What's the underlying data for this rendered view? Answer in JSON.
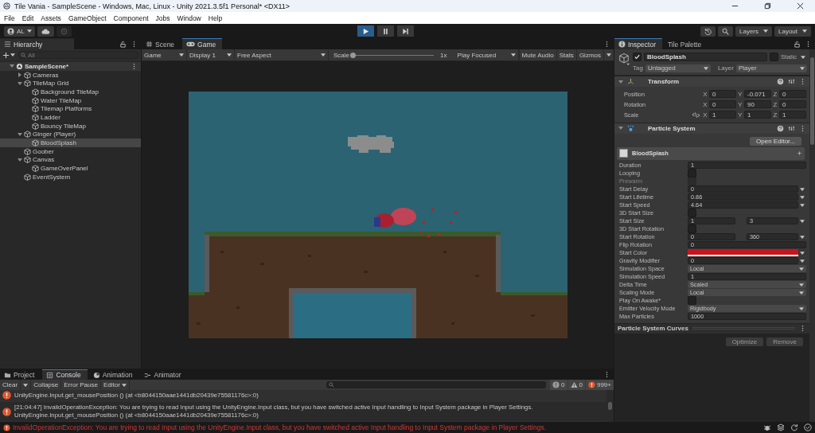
{
  "window": {
    "title": "Tile Vania - SampleScene - Windows, Mac, Linux - Unity 2021.3.5f1 Personal* <DX11>"
  },
  "menu": [
    "File",
    "Edit",
    "Assets",
    "GameObject",
    "Component",
    "Jobs",
    "Window",
    "Help"
  ],
  "toolbar": {
    "account": "AL",
    "playing": true,
    "paused": false,
    "layers": "Layers",
    "layout": "Layout"
  },
  "hierarchy": {
    "title": "Hierarchy",
    "search_placeholder": "All",
    "scene": {
      "name": "SampleScene*",
      "expanded": true,
      "selected": false,
      "children": [
        {
          "name": "Cameras",
          "expanded": false,
          "selected": false
        },
        {
          "name": "TileMap Grid",
          "expanded": true,
          "selected": false,
          "children": [
            {
              "name": "Background TileMap",
              "selected": false
            },
            {
              "name": "Water TileMap",
              "selected": false
            },
            {
              "name": "Tilemap Platforms",
              "selected": false
            },
            {
              "name": "Ladder",
              "selected": false
            },
            {
              "name": "Bouncy TileMap",
              "selected": false
            }
          ]
        },
        {
          "name": "Ginger (Player)",
          "expanded": true,
          "selected": false,
          "children": [
            {
              "name": "BloodSplash",
              "selected": true
            }
          ]
        },
        {
          "name": "Goober",
          "selected": false
        },
        {
          "name": "Canvas",
          "expanded": true,
          "selected": false,
          "children": [
            {
              "name": "GameOverPanel",
              "selected": false
            }
          ]
        },
        {
          "name": "EventSystem",
          "selected": false
        }
      ]
    }
  },
  "game": {
    "tabs": [
      {
        "label": "Scene",
        "selected": false
      },
      {
        "label": "Game",
        "selected": true
      }
    ],
    "bar": {
      "display_mode": "Game",
      "display": "Display 1",
      "aspect": "Free Aspect",
      "scale_label": "Scale",
      "scale": {
        "level": 0
      },
      "scale_value": "1x",
      "play_mode": "Play Focused",
      "toggles": [
        {
          "label": "Mute Audio",
          "on": false
        },
        {
          "label": "Stats",
          "on": false
        }
      ],
      "gizmos": "Gizmos"
    }
  },
  "inspector": {
    "tabs": [
      {
        "label": "Inspector",
        "selected": true
      },
      {
        "label": "Tile Palette",
        "selected": false
      }
    ],
    "object": {
      "active": true,
      "name": "BloodSplash",
      "static_label": "Static",
      "static": false,
      "tag_label": "Tag",
      "tag": "Untagged",
      "layer_label": "Layer",
      "layer": "Player"
    },
    "transform": {
      "title": "Transform",
      "expanded": true,
      "rows": [
        {
          "label": "Position",
          "values": [
            {
              "axis": "X",
              "value": "0"
            },
            {
              "axis": "Y",
              "value": "-0.071"
            },
            {
              "axis": "Z",
              "value": "0"
            }
          ]
        },
        {
          "label": "Rotation",
          "values": [
            {
              "axis": "X",
              "value": "0"
            },
            {
              "axis": "Y",
              "value": "90"
            },
            {
              "axis": "Z",
              "value": "0"
            }
          ]
        },
        {
          "label": "Scale",
          "proportions_locked": false,
          "values": [
            {
              "axis": "X",
              "value": "1"
            },
            {
              "axis": "Y",
              "value": "1"
            },
            {
              "axis": "Z",
              "value": "1"
            }
          ]
        }
      ]
    },
    "particle_system": {
      "title": "Particle System",
      "expanded": true,
      "open_editor": "Open Editor...",
      "module": "BloodSplash",
      "properties": [
        {
          "label": "Duration",
          "kind": "text",
          "value": "1",
          "disabled": false
        },
        {
          "label": "Looping",
          "kind": "checkbox",
          "checked": false,
          "disabled": false
        },
        {
          "label": "Prewarm",
          "kind": "checkbox",
          "checked": false,
          "disabled": true
        },
        {
          "label": "Start Delay",
          "kind": "curve",
          "value": "0",
          "disabled": false
        },
        {
          "label": "Start Lifetime",
          "kind": "curve",
          "value": "0.86",
          "disabled": false
        },
        {
          "label": "Start Speed",
          "kind": "curve",
          "value": "4.64",
          "disabled": false
        },
        {
          "label": "3D Start Size",
          "kind": "checkbox",
          "checked": false,
          "disabled": false
        },
        {
          "label": "Start Size",
          "kind": "pair",
          "value": "1",
          "value_2": "3",
          "disabled": false
        },
        {
          "label": "3D Start Rotation",
          "kind": "checkbox",
          "checked": false,
          "disabled": false
        },
        {
          "label": "Start Rotation",
          "kind": "pair",
          "value": "0",
          "value_2": "360",
          "disabled": false
        },
        {
          "label": "Flip Rotation",
          "kind": "text",
          "value": "0",
          "disabled": false
        },
        {
          "label": "Start Color",
          "kind": "color",
          "color": "#c8141c",
          "disabled": false
        },
        {
          "label": "Gravity Modifier",
          "kind": "curve",
          "value": "0",
          "disabled": false
        },
        {
          "label": "Simulation Space",
          "kind": "dropdown",
          "value": "Local",
          "disabled": false
        },
        {
          "label": "Simulation Speed",
          "kind": "text",
          "value": "1",
          "disabled": false
        },
        {
          "label": "Delta Time",
          "kind": "dropdown",
          "value": "Scaled",
          "disabled": false
        },
        {
          "label": "Scaling Mode",
          "kind": "dropdown",
          "value": "Local",
          "disabled": false
        },
        {
          "label": "Play On Awake*",
          "kind": "checkbox",
          "checked": false,
          "disabled": false
        },
        {
          "label": "Emitter Velocity Mode",
          "kind": "dropdown",
          "value": "Rigidbody",
          "disabled": false
        },
        {
          "label": "Max Particles",
          "kind": "text",
          "value": "1000",
          "disabled": false
        }
      ]
    },
    "curves_title": "Particle System Curves",
    "buttons": [
      {
        "label": "Optimize",
        "disabled": true
      },
      {
        "label": "Remove",
        "disabled": true
      }
    ]
  },
  "console": {
    "tabs": [
      {
        "label": "Project",
        "selected": false
      },
      {
        "label": "Console",
        "selected": true
      },
      {
        "label": "Animation",
        "selected": false
      },
      {
        "label": "Animator",
        "selected": false
      }
    ],
    "tools": {
      "clear": "Clear",
      "collapse": "Collapse",
      "error_pause": "Error Pause",
      "editor": "Editor"
    },
    "counts": [
      {
        "kind": "info",
        "count": "0"
      },
      {
        "kind": "warning",
        "count": "0"
      },
      {
        "kind": "error",
        "count": "999+"
      }
    ],
    "entries": [
      {
        "lines": [
          "UnityEngine.Input.get_mousePosition () (at <b8044150aae1441db20439e75581176c>:0)"
        ]
      },
      {
        "lines": [
          "[21:04:47] InvalidOperationException: You are trying to read Input using the UnityEngine.Input class, but you have switched active Input handling to Input System package in Player Settings.",
          "UnityEngine.Input.get_mousePosition () (at <b8044150aae1441db20439e75581176c>:0)"
        ]
      }
    ]
  },
  "status_bar": {
    "message": "InvalidOperationException: You are trying to read Input using the UnityEngine.Input class, but you have switched active Input handling to Input System package in Player Settings."
  }
}
